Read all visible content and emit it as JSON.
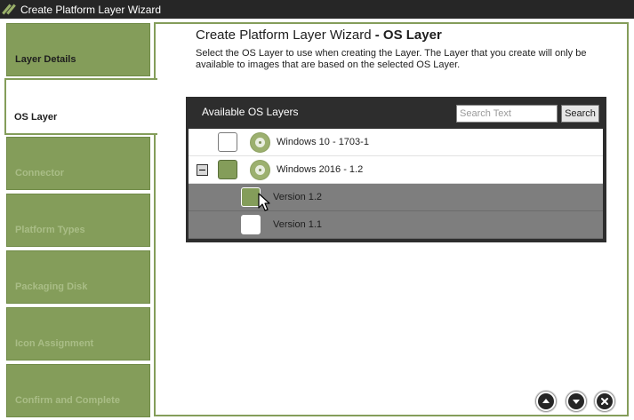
{
  "window": {
    "title": "Create Platform Layer Wizard"
  },
  "sidebar": {
    "steps": [
      {
        "label": "Layer Details",
        "state": "done"
      },
      {
        "label": "OS Layer",
        "state": "active"
      },
      {
        "label": "Connector",
        "state": "pending"
      },
      {
        "label": "Platform Types",
        "state": "pending"
      },
      {
        "label": "Packaging Disk",
        "state": "pending"
      },
      {
        "label": "Icon Assignment",
        "state": "pending"
      },
      {
        "label": "Confirm and Complete",
        "state": "pending"
      }
    ]
  },
  "main": {
    "title_prefix": "Create Platform Layer Wizard",
    "title_suffix": "- OS Layer",
    "description": "Select the OS Layer to use when creating the Layer. The Layer that you create will only be available to images that are based on the selected OS Layer.",
    "panel": {
      "title": "Available OS Layers",
      "search_placeholder": "Search Text",
      "search_value": "",
      "search_button": "Search",
      "rows": [
        {
          "label": "Windows 10 - 1703-1",
          "checked": false,
          "expanded": false
        },
        {
          "label": "Windows 2016 - 1.2",
          "checked": true,
          "expanded": true
        },
        {
          "label": "Version 1.2",
          "checked": true
        },
        {
          "label": "Version 1.1",
          "checked": false
        }
      ]
    }
  },
  "footer": {
    "buttons": [
      {
        "icon": "arrow-up-icon"
      },
      {
        "icon": "arrow-down-icon"
      },
      {
        "icon": "close-icon"
      }
    ]
  },
  "colors": {
    "accent": "#849d5a",
    "titlebar": "#262626",
    "panel": "#2d2d2d",
    "row_dark": "#7e7e7e"
  }
}
